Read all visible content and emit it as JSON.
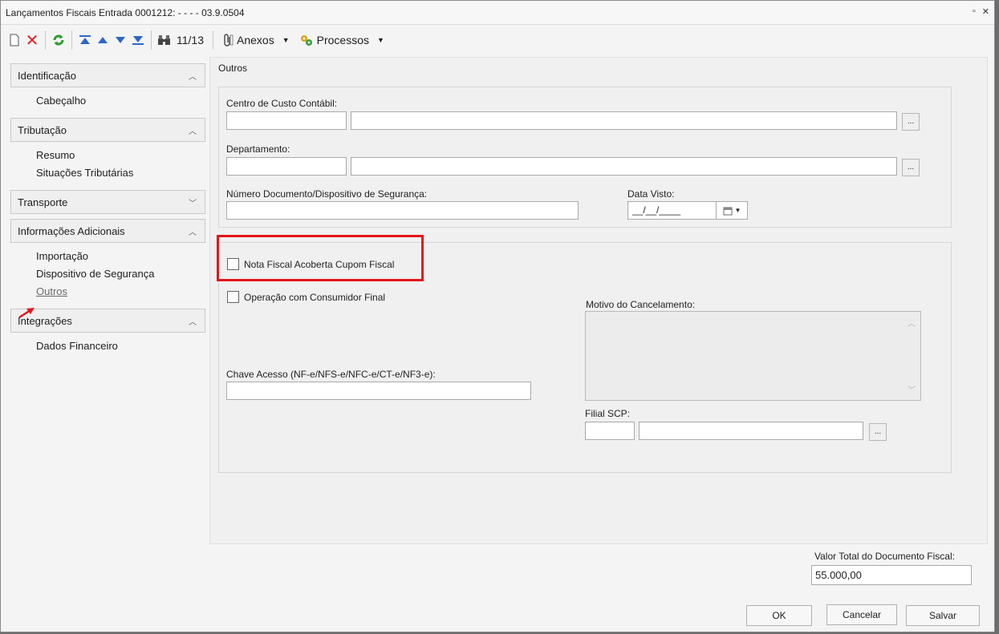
{
  "window": {
    "title": "Lançamentos Fiscais Entrada 0001212: - - - - 03.9.0504",
    "controls": [
      "▫",
      "✕"
    ]
  },
  "toolbar": {
    "record_counter": "11/13",
    "anexos_label": "Anexos",
    "processos_label": "Processos"
  },
  "sidebar": {
    "sections": [
      {
        "title": "Identificação",
        "items": [
          "Cabeçalho"
        ]
      },
      {
        "title": "Tributação",
        "items": [
          "Resumo",
          "Situações Tributárias"
        ]
      },
      {
        "title": "Transporte",
        "items": []
      },
      {
        "title": "Informações Adicionais",
        "items": [
          "Importação",
          "Dispositivo de Segurança",
          "Outros"
        ]
      },
      {
        "title": "Integrações",
        "items": [
          "Dados Financeiro"
        ]
      }
    ]
  },
  "main": {
    "section_title": "Outros",
    "centro_custo_label": "Centro de Custo Contábil:",
    "departamento_label": "Departamento:",
    "numero_documento_label": "Número Documento/Dispositivo de Segurança:",
    "data_visto_label": "Data Visto:",
    "data_visto_value": "__/__/____",
    "nota_fiscal_label": "Nota Fiscal  Acoberta Cupom Fiscal",
    "consumidor_final_label": "Operação com Consumidor Final",
    "motivo_cancelamento_label": "Motivo do Cancelamento:",
    "chave_acesso_label": "Chave Acesso (NF-e/NFS-e/NFC-e/CT-e/NF3-e):",
    "filial_scp_label": "Filial SCP:",
    "ellipsis": "..."
  },
  "footer": {
    "valor_total_label": "Valor Total do Documento Fiscal:",
    "valor_total_value": "55.000,00",
    "ok_label": "OK",
    "cancelar_label": "Cancelar",
    "salvar_label": "Salvar"
  },
  "colors": {
    "highlight": "#e3151b",
    "arrow": "#e3151b"
  }
}
